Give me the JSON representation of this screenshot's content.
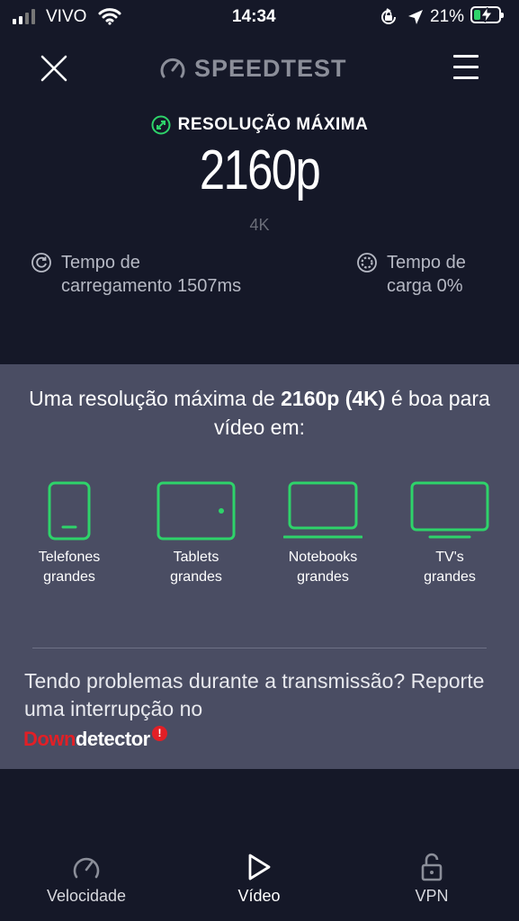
{
  "status_bar": {
    "carrier": "VIVO",
    "time": "14:34",
    "battery_percent": "21%",
    "battery_level": 0.21,
    "icons": [
      "signal-bars-icon",
      "wifi-icon",
      "orientation-lock-icon",
      "location-arrow-icon",
      "battery-charging-icon"
    ]
  },
  "header": {
    "brand": "SPEEDTEST",
    "close_icon": "close-icon",
    "menu_icon": "hamburger-menu-icon"
  },
  "resolution": {
    "label": "RESOLUÇÃO MÁXIMA",
    "value": "2160p",
    "tag": "4K"
  },
  "stats": {
    "load_time_line1": "Tempo de",
    "load_time_line2": "carregamento 1507ms",
    "buffer_line1": "Tempo de",
    "buffer_line2": "carga 0%"
  },
  "panel": {
    "text_before": "Uma resolução máxima de ",
    "text_bold": "2160p (4K)",
    "text_after": " é boa para vídeo em:",
    "devices": [
      {
        "line1": "Telefones",
        "line2": "grandes",
        "icon": "phone-icon"
      },
      {
        "line1": "Tablets",
        "line2": "grandes",
        "icon": "tablet-icon"
      },
      {
        "line1": "Notebooks",
        "line2": "grandes",
        "icon": "laptop-icon"
      },
      {
        "line1": "TV's",
        "line2": "grandes",
        "icon": "tv-icon"
      }
    ],
    "problem_text": "Tendo problemas durante a transmissão? Reporte uma interrupção no",
    "downdetector": {
      "part1": "Down",
      "part2": "detector",
      "badge": "!"
    }
  },
  "tabs": [
    {
      "label": "Velocidade",
      "icon": "speedometer-icon",
      "active": false
    },
    {
      "label": "Vídeo",
      "icon": "play-icon",
      "active": true
    },
    {
      "label": "VPN",
      "icon": "padlock-icon",
      "active": false
    }
  ],
  "colors": {
    "background": "#151828",
    "panel": "#4a4d63",
    "accent_green": "#2ed36a",
    "downdetector_red": "#e21f26"
  }
}
